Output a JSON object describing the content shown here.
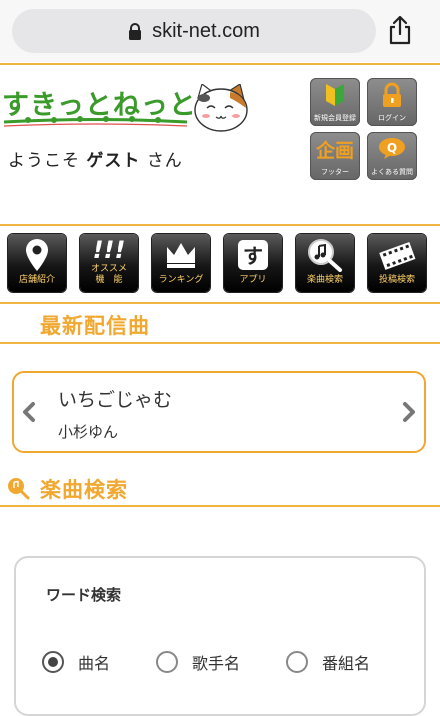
{
  "browser": {
    "url": "skit-net.com"
  },
  "header": {
    "logo_text": "すきっとねっと",
    "welcome_prefix": "ようこそ",
    "user_name": "ゲスト",
    "welcome_suffix": "さん",
    "buttons": [
      {
        "label": "新規会員登録",
        "glyph": "beginner-mark-icon"
      },
      {
        "label": "ログイン",
        "glyph": "lock-icon"
      },
      {
        "label": "フッター",
        "glyph": "企画"
      },
      {
        "label": "よくある質問",
        "glyph": "Q"
      }
    ]
  },
  "nav": [
    {
      "label": "店舗紹介",
      "icon": "location-pin-icon"
    },
    {
      "label": "オススメ\n機　能",
      "icon": "!!!"
    },
    {
      "label": "ランキング",
      "icon": "crown-icon"
    },
    {
      "label": "アプリ",
      "icon": "app-icon"
    },
    {
      "label": "楽曲検索",
      "icon": "music-search-icon"
    },
    {
      "label": "投稿検索",
      "icon": "film-strip-icon"
    }
  ],
  "latest": {
    "heading": "最新配信曲",
    "song_title": "いちごじゃむ",
    "artist": "小杉ゆん"
  },
  "search": {
    "heading": "楽曲検索",
    "card_title": "ワード検索",
    "options": [
      {
        "label": "曲名",
        "selected": true
      },
      {
        "label": "歌手名",
        "selected": false
      },
      {
        "label": "番組名",
        "selected": false
      }
    ]
  },
  "colors": {
    "accent": "#f0a830",
    "logo_green": "#3a9a2a"
  }
}
